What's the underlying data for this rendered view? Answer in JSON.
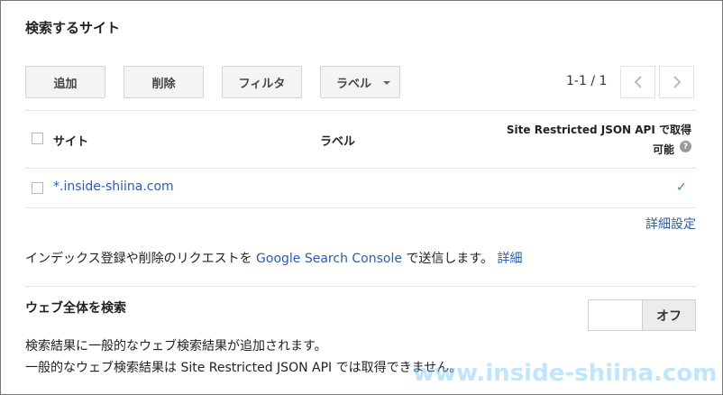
{
  "section_title": "検索するサイト",
  "toolbar": {
    "add_label": "追加",
    "delete_label": "削除",
    "filter_label": "フィルタ",
    "label_label": "ラベル"
  },
  "pager": {
    "range_text": "1-1 / 1"
  },
  "table": {
    "headers": {
      "site": "サイト",
      "label": "ラベル",
      "api_line1": "Site Restricted JSON API で取得",
      "api_line2": "可能"
    },
    "rows": [
      {
        "site": "*.inside-shiina.com",
        "label": "",
        "api_available": true
      }
    ]
  },
  "advanced_settings_link": "詳細設定",
  "info": {
    "prefix": "インデックス登録や削除のリクエストを ",
    "console_link": "Google Search Console",
    "suffix": " で送信します。 ",
    "details_link": "詳細"
  },
  "web_search": {
    "title": "ウェブ全体を検索",
    "toggle_label": "オフ",
    "desc_line1": "検索結果に一般的なウェブ検索結果が追加されます。",
    "desc_line2": "一般的なウェブ検索結果は Site Restricted JSON API では取得できません。"
  },
  "watermark": "www.inside-shiina.com",
  "colors": {
    "link": "#2a5db0",
    "check": "#3a9a3a",
    "button_bg": "#f4f4f4"
  },
  "icons": [
    "chevron-left-icon",
    "chevron-right-icon",
    "caret-down-icon",
    "help-icon",
    "checkmark-icon"
  ]
}
